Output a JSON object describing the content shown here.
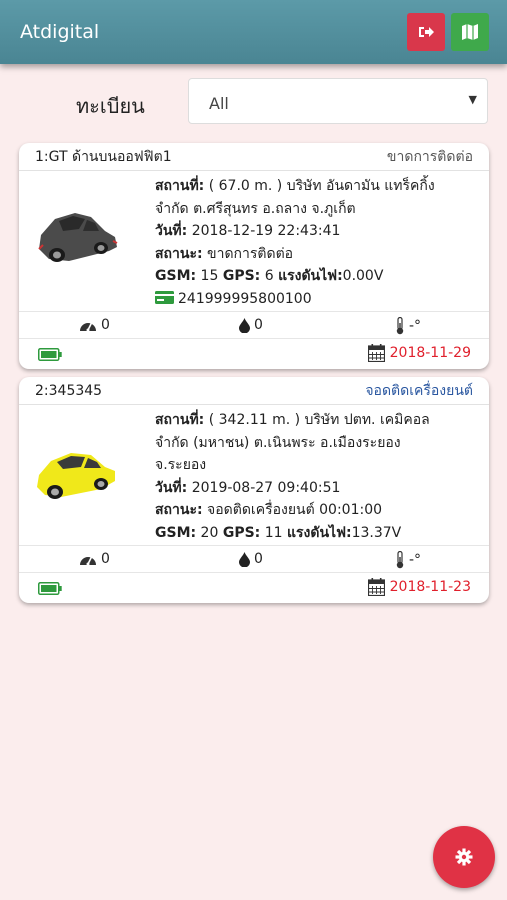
{
  "app": {
    "title": "Atdigital"
  },
  "colors": {
    "appbar": "#4f8d9b",
    "logout": "#d9374b",
    "map": "#3fa94b",
    "fab": "#e03245",
    "date": "#e0202c",
    "background": "#fbeded"
  },
  "icons": {
    "logout": "sign-out-icon",
    "map": "map-icon",
    "settings": "gear-icon"
  },
  "filter": {
    "label": "ทะเบียน",
    "selected": "All"
  },
  "vehicles": [
    {
      "name": "1:GT ด้านบนออฟฟิต1",
      "status": "ขาดการติดต่อ",
      "car_color": "gray",
      "location_label": "สถานที่:",
      "location_line1": " ( 67.0 m. ) บริษัท อันดามัน แทร็คกิ้ง",
      "location_line2": "จำกัด ต.ศรีสุนทร อ.ถลาง จ.ภูเก็ต",
      "date_label": "วันที่:",
      "date_value": " 2018-12-19 22:43:41",
      "state_label": "สถานะ:",
      "state_value": " ขาดการติดต่อ",
      "gsm_label": "GSM:",
      "gsm_value": " 15 ",
      "gps_label": "GPS:",
      "gps_value": " 6 ",
      "volt_label": "แรงดันไฟ:",
      "volt_value": "0.00V",
      "sim": "241999995800100",
      "speed": "0",
      "fuel": "0",
      "temp": "-°",
      "expire": "2018-11-29"
    },
    {
      "name": "2:345345",
      "status": "จอดติดเครื่องยนต์",
      "car_color": "yellow",
      "location_label": "สถานที่:",
      "location_line1": " ( 342.11 m. ) บริษัท ปตท. เคมิคอล",
      "location_line2": "จำกัด (มหาชน) ต.เนินพระ อ.เมืองระยอง",
      "location_line3": "จ.ระยอง",
      "date_label": "วันที่:",
      "date_value": " 2019-08-27 09:40:51",
      "state_label": "สถานะ:",
      "state_value": " จอดติดเครื่องยนต์ 00:01:00",
      "gsm_label": "GSM:",
      "gsm_value": " 20 ",
      "gps_label": "GPS:",
      "gps_value": " 11 ",
      "volt_label": "แรงดันไฟ:",
      "volt_value": "13.37V",
      "speed": "0",
      "fuel": "0",
      "temp": "-°",
      "expire": "2018-11-23"
    }
  ]
}
